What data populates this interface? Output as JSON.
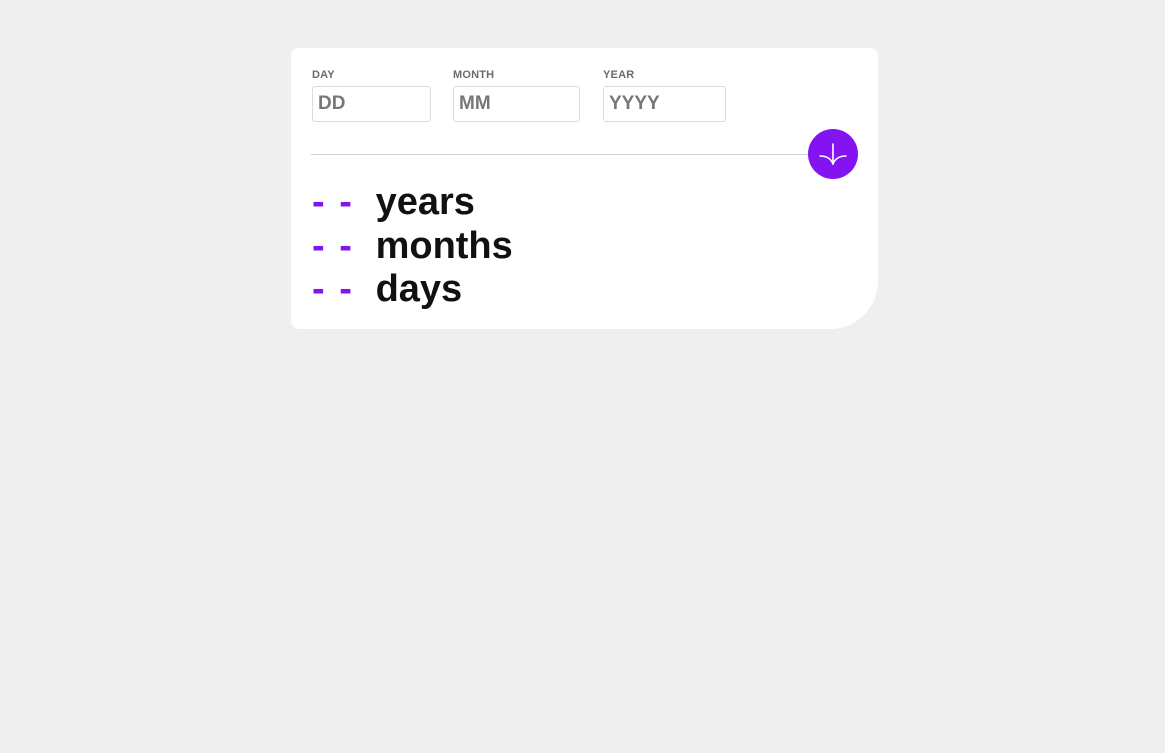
{
  "form": {
    "day": {
      "label": "DAY",
      "placeholder": "DD",
      "value": ""
    },
    "month": {
      "label": "MONTH",
      "placeholder": "MM",
      "value": ""
    },
    "year": {
      "label": "YEAR",
      "placeholder": "YYYY",
      "value": ""
    }
  },
  "submit": {
    "icon": "arrow-down-icon"
  },
  "results": [
    {
      "value": "- -",
      "unit": "years"
    },
    {
      "value": "- -",
      "unit": "months"
    },
    {
      "value": "- -",
      "unit": "days"
    }
  ],
  "colors": {
    "accent": "#8413f2",
    "background": "#efefef",
    "card": "#ffffff",
    "text": "#111111",
    "label": "#6b6b6b"
  }
}
